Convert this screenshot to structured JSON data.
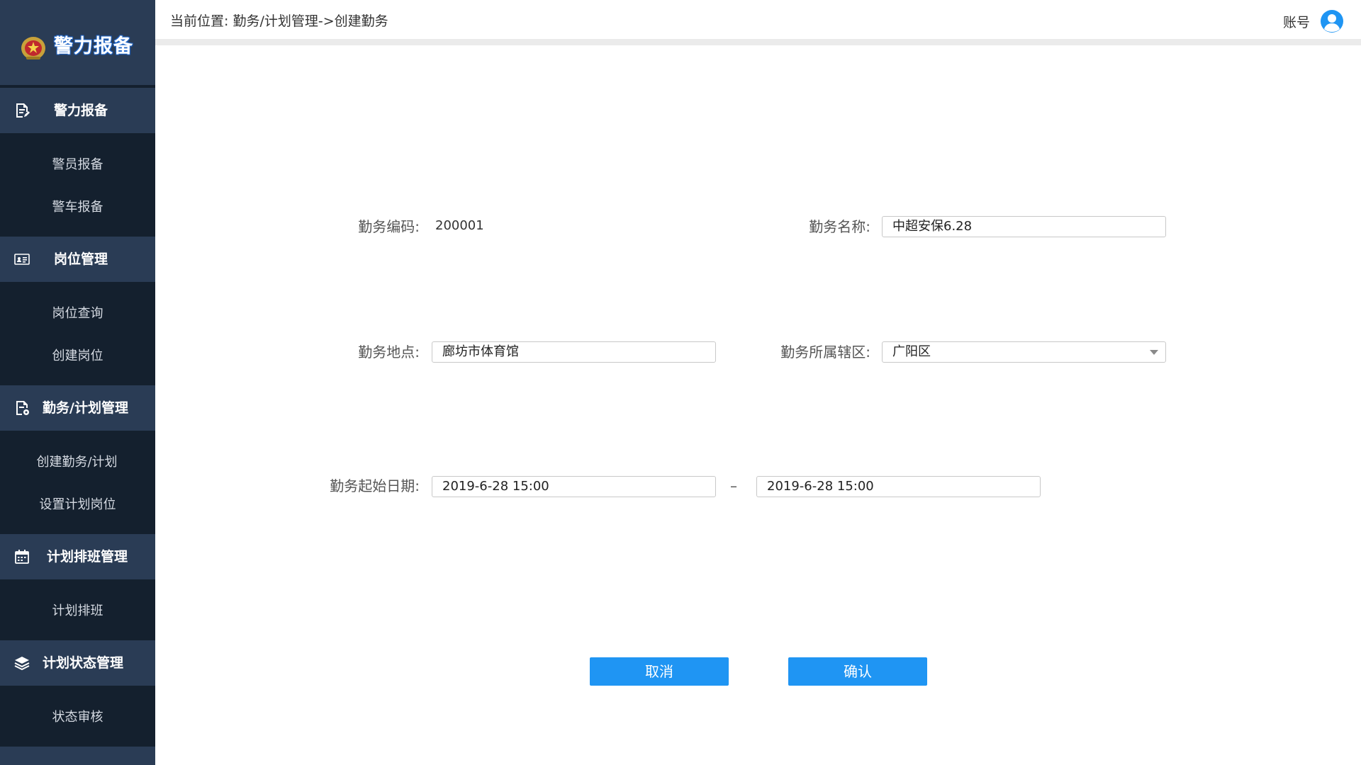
{
  "app": {
    "title": "警力报备"
  },
  "sidebar": {
    "groups": [
      {
        "label": "警力报备",
        "icon": "document-edit-icon",
        "items": [
          "警员报备",
          "警车报备"
        ]
      },
      {
        "label": "岗位管理",
        "icon": "id-card-icon",
        "items": [
          "岗位查询",
          "创建岗位"
        ]
      },
      {
        "label": "勤务/计划管理",
        "icon": "document-settings-icon",
        "items": [
          "创建勤务/计划",
          "设置计划岗位"
        ]
      },
      {
        "label": "计划排班管理",
        "icon": "calendar-icon",
        "items": [
          "计划排班"
        ]
      },
      {
        "label": "计划状态管理",
        "icon": "layers-icon",
        "items": [
          "状态审核"
        ]
      }
    ]
  },
  "header": {
    "breadcrumb": "当前位置:  勤务/计划管理->创建勤务",
    "account_label": "账号"
  },
  "form": {
    "code_label": "勤务编码:",
    "code_value": "200001",
    "name_label": "勤务名称:",
    "name_value": "中超安保6.28",
    "location_label": "勤务地点:",
    "location_value": "廊坊市体育馆",
    "district_label": "勤务所属辖区:",
    "district_value": "广阳区",
    "date_label": "勤务起始日期:",
    "start_date": "2019-6-28  15:00",
    "date_separator": "–",
    "end_date": "2019-6-28  15:00"
  },
  "actions": {
    "cancel_label": "取消",
    "confirm_label": "确认"
  },
  "colors": {
    "sidebar_bg": "#14202e",
    "group_bg": "#2a3c55",
    "primary": "#1f95f3"
  }
}
